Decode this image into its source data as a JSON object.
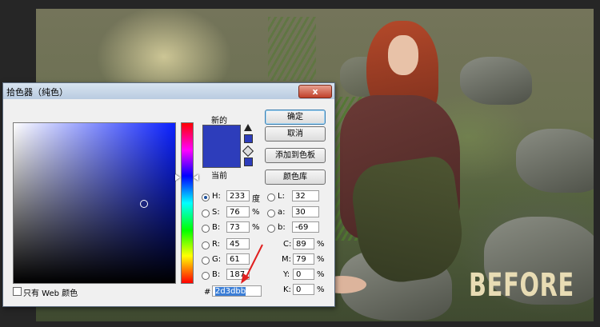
{
  "dialog": {
    "title": "拾色器（纯色）",
    "close_glyph": "x",
    "new_label": "新的",
    "current_label": "当前",
    "buttons": {
      "ok": "确定",
      "cancel": "取消",
      "add_to_swatches": "添加到色板",
      "color_libraries": "颜色库"
    },
    "web_colors_label": "只有 Web 颜色",
    "hsb": {
      "h": {
        "label": "H:",
        "value": "233",
        "unit": "度"
      },
      "s": {
        "label": "S:",
        "value": "76",
        "unit": "%"
      },
      "b": {
        "label": "B:",
        "value": "73",
        "unit": "%"
      }
    },
    "rgb": {
      "r": {
        "label": "R:",
        "value": "45"
      },
      "g": {
        "label": "G:",
        "value": "61"
      },
      "b": {
        "label": "B:",
        "value": "187"
      }
    },
    "lab": {
      "l": {
        "label": "L:",
        "value": "32"
      },
      "a": {
        "label": "a:",
        "value": "30"
      },
      "b": {
        "label": "b:",
        "value": "-69"
      }
    },
    "cmyk": {
      "c": {
        "label": "C:",
        "value": "89",
        "unit": "%"
      },
      "m": {
        "label": "M:",
        "value": "79",
        "unit": "%"
      },
      "y": {
        "label": "Y:",
        "value": "0",
        "unit": "%"
      },
      "k": {
        "label": "K:",
        "value": "0",
        "unit": "%"
      }
    },
    "hex_prefix": "#",
    "hex_value": "2d3dbb",
    "colors": {
      "selected": "#2d3dbb",
      "pointer_arrow": "#e02020"
    }
  },
  "photo": {
    "watermark": "BEFORE"
  }
}
